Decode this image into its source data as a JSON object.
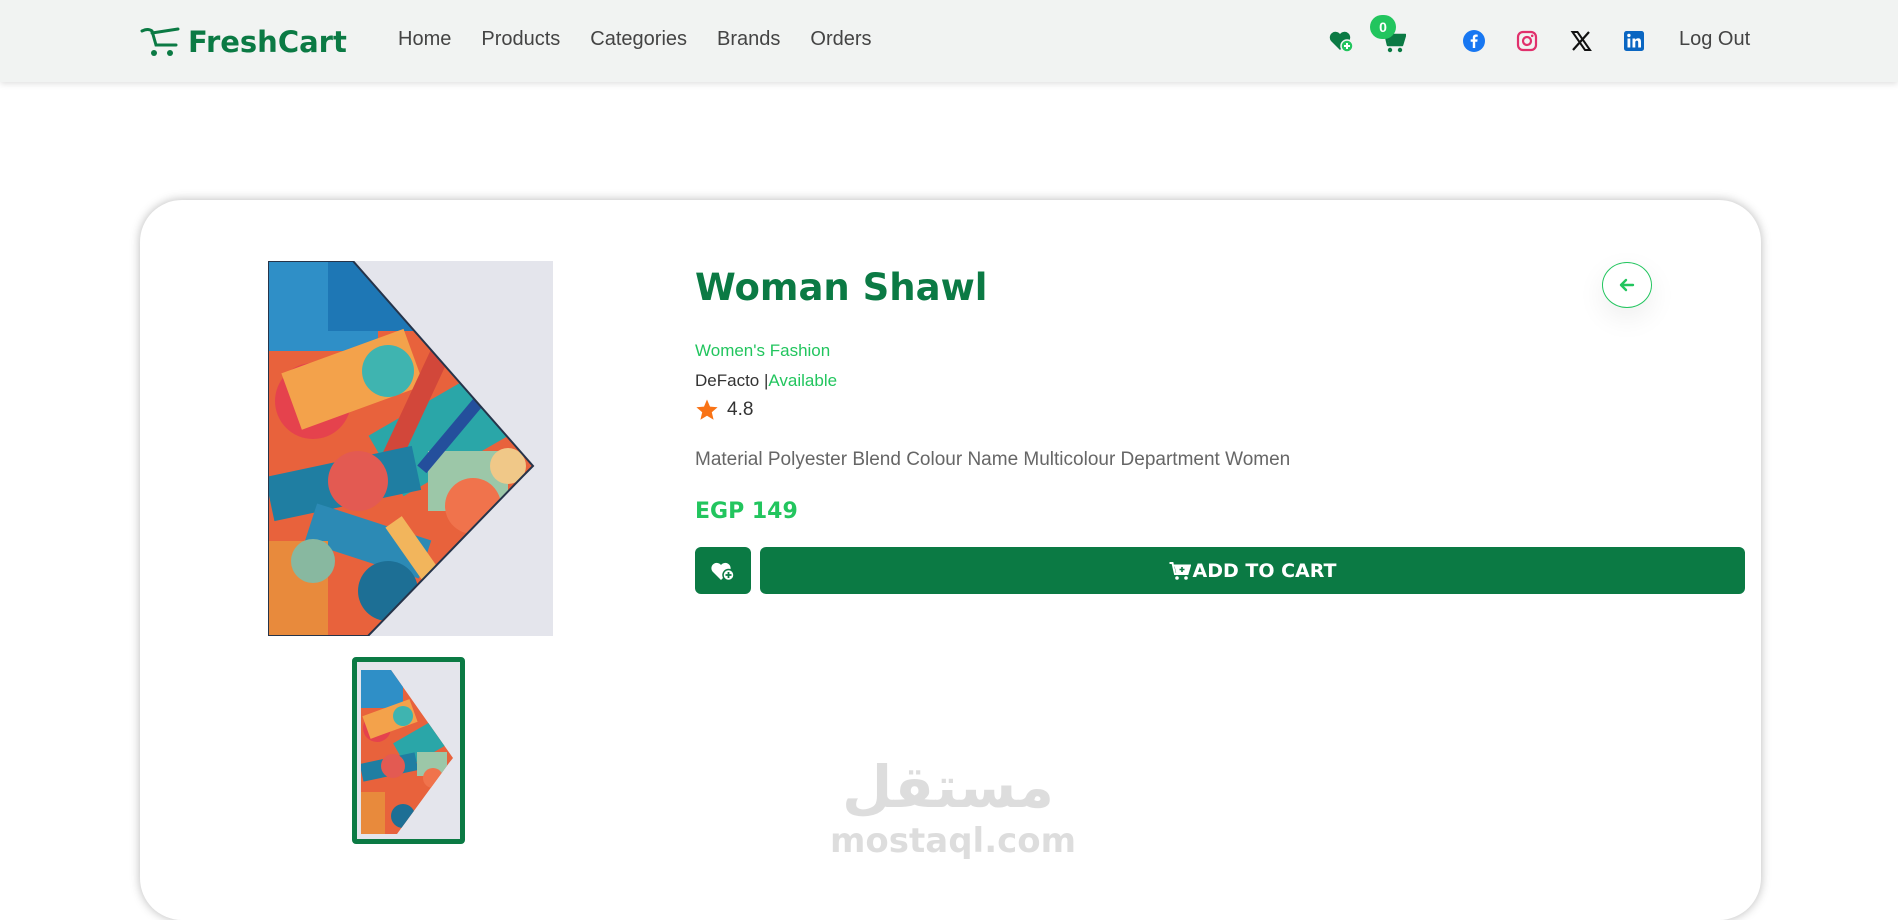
{
  "navbar": {
    "brand": "FreshCart",
    "links": [
      "Home",
      "Products",
      "Categories",
      "Brands",
      "Orders"
    ],
    "cart_count": "0",
    "logout": "Log Out",
    "icons": [
      "heart-plus-icon",
      "cart-icon",
      "facebook-icon",
      "instagram-icon",
      "x-icon",
      "linkedin-icon"
    ]
  },
  "product": {
    "title": "Woman Shawl",
    "category": "Women's Fashion",
    "brand": "DeFacto",
    "separator": " |",
    "availability": "Available",
    "rating": "4.8",
    "description": "Material Polyester Blend Colour Name Multicolour Department Women",
    "price": "EGP 149",
    "add_to_cart": "ADD TO CART"
  },
  "watermark": {
    "arabic": "مستقل",
    "latin": "mostaql.com"
  },
  "colors": {
    "brand_green": "#0b7a44",
    "accent_green": "#22c55e",
    "navbar_bg": "#f1f3f2",
    "star": "#f97316",
    "facebook": "#1877f2",
    "instagram": "#e1306c",
    "linkedin": "#0a66c2"
  }
}
